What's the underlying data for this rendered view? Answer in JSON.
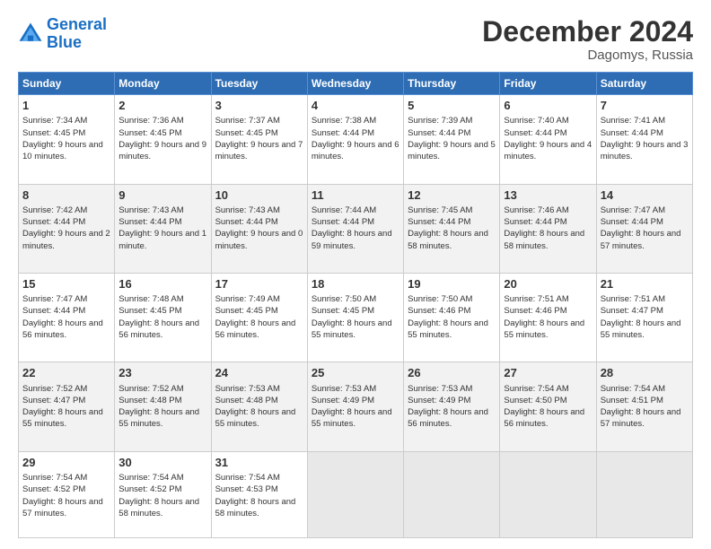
{
  "header": {
    "logo_line1": "General",
    "logo_line2": "Blue",
    "month": "December 2024",
    "location": "Dagomys, Russia"
  },
  "weekdays": [
    "Sunday",
    "Monday",
    "Tuesday",
    "Wednesday",
    "Thursday",
    "Friday",
    "Saturday"
  ],
  "weeks": [
    [
      {
        "day": "1",
        "sunrise": "Sunrise: 7:34 AM",
        "sunset": "Sunset: 4:45 PM",
        "daylight": "Daylight: 9 hours and 10 minutes."
      },
      {
        "day": "2",
        "sunrise": "Sunrise: 7:36 AM",
        "sunset": "Sunset: 4:45 PM",
        "daylight": "Daylight: 9 hours and 9 minutes."
      },
      {
        "day": "3",
        "sunrise": "Sunrise: 7:37 AM",
        "sunset": "Sunset: 4:45 PM",
        "daylight": "Daylight: 9 hours and 7 minutes."
      },
      {
        "day": "4",
        "sunrise": "Sunrise: 7:38 AM",
        "sunset": "Sunset: 4:44 PM",
        "daylight": "Daylight: 9 hours and 6 minutes."
      },
      {
        "day": "5",
        "sunrise": "Sunrise: 7:39 AM",
        "sunset": "Sunset: 4:44 PM",
        "daylight": "Daylight: 9 hours and 5 minutes."
      },
      {
        "day": "6",
        "sunrise": "Sunrise: 7:40 AM",
        "sunset": "Sunset: 4:44 PM",
        "daylight": "Daylight: 9 hours and 4 minutes."
      },
      {
        "day": "7",
        "sunrise": "Sunrise: 7:41 AM",
        "sunset": "Sunset: 4:44 PM",
        "daylight": "Daylight: 9 hours and 3 minutes."
      }
    ],
    [
      {
        "day": "8",
        "sunrise": "Sunrise: 7:42 AM",
        "sunset": "Sunset: 4:44 PM",
        "daylight": "Daylight: 9 hours and 2 minutes."
      },
      {
        "day": "9",
        "sunrise": "Sunrise: 7:43 AM",
        "sunset": "Sunset: 4:44 PM",
        "daylight": "Daylight: 9 hours and 1 minute."
      },
      {
        "day": "10",
        "sunrise": "Sunrise: 7:43 AM",
        "sunset": "Sunset: 4:44 PM",
        "daylight": "Daylight: 9 hours and 0 minutes."
      },
      {
        "day": "11",
        "sunrise": "Sunrise: 7:44 AM",
        "sunset": "Sunset: 4:44 PM",
        "daylight": "Daylight: 8 hours and 59 minutes."
      },
      {
        "day": "12",
        "sunrise": "Sunrise: 7:45 AM",
        "sunset": "Sunset: 4:44 PM",
        "daylight": "Daylight: 8 hours and 58 minutes."
      },
      {
        "day": "13",
        "sunrise": "Sunrise: 7:46 AM",
        "sunset": "Sunset: 4:44 PM",
        "daylight": "Daylight: 8 hours and 58 minutes."
      },
      {
        "day": "14",
        "sunrise": "Sunrise: 7:47 AM",
        "sunset": "Sunset: 4:44 PM",
        "daylight": "Daylight: 8 hours and 57 minutes."
      }
    ],
    [
      {
        "day": "15",
        "sunrise": "Sunrise: 7:47 AM",
        "sunset": "Sunset: 4:44 PM",
        "daylight": "Daylight: 8 hours and 56 minutes."
      },
      {
        "day": "16",
        "sunrise": "Sunrise: 7:48 AM",
        "sunset": "Sunset: 4:45 PM",
        "daylight": "Daylight: 8 hours and 56 minutes."
      },
      {
        "day": "17",
        "sunrise": "Sunrise: 7:49 AM",
        "sunset": "Sunset: 4:45 PM",
        "daylight": "Daylight: 8 hours and 56 minutes."
      },
      {
        "day": "18",
        "sunrise": "Sunrise: 7:50 AM",
        "sunset": "Sunset: 4:45 PM",
        "daylight": "Daylight: 8 hours and 55 minutes."
      },
      {
        "day": "19",
        "sunrise": "Sunrise: 7:50 AM",
        "sunset": "Sunset: 4:46 PM",
        "daylight": "Daylight: 8 hours and 55 minutes."
      },
      {
        "day": "20",
        "sunrise": "Sunrise: 7:51 AM",
        "sunset": "Sunset: 4:46 PM",
        "daylight": "Daylight: 8 hours and 55 minutes."
      },
      {
        "day": "21",
        "sunrise": "Sunrise: 7:51 AM",
        "sunset": "Sunset: 4:47 PM",
        "daylight": "Daylight: 8 hours and 55 minutes."
      }
    ],
    [
      {
        "day": "22",
        "sunrise": "Sunrise: 7:52 AM",
        "sunset": "Sunset: 4:47 PM",
        "daylight": "Daylight: 8 hours and 55 minutes."
      },
      {
        "day": "23",
        "sunrise": "Sunrise: 7:52 AM",
        "sunset": "Sunset: 4:48 PM",
        "daylight": "Daylight: 8 hours and 55 minutes."
      },
      {
        "day": "24",
        "sunrise": "Sunrise: 7:53 AM",
        "sunset": "Sunset: 4:48 PM",
        "daylight": "Daylight: 8 hours and 55 minutes."
      },
      {
        "day": "25",
        "sunrise": "Sunrise: 7:53 AM",
        "sunset": "Sunset: 4:49 PM",
        "daylight": "Daylight: 8 hours and 55 minutes."
      },
      {
        "day": "26",
        "sunrise": "Sunrise: 7:53 AM",
        "sunset": "Sunset: 4:49 PM",
        "daylight": "Daylight: 8 hours and 56 minutes."
      },
      {
        "day": "27",
        "sunrise": "Sunrise: 7:54 AM",
        "sunset": "Sunset: 4:50 PM",
        "daylight": "Daylight: 8 hours and 56 minutes."
      },
      {
        "day": "28",
        "sunrise": "Sunrise: 7:54 AM",
        "sunset": "Sunset: 4:51 PM",
        "daylight": "Daylight: 8 hours and 57 minutes."
      }
    ],
    [
      {
        "day": "29",
        "sunrise": "Sunrise: 7:54 AM",
        "sunset": "Sunset: 4:52 PM",
        "daylight": "Daylight: 8 hours and 57 minutes."
      },
      {
        "day": "30",
        "sunrise": "Sunrise: 7:54 AM",
        "sunset": "Sunset: 4:52 PM",
        "daylight": "Daylight: 8 hours and 58 minutes."
      },
      {
        "day": "31",
        "sunrise": "Sunrise: 7:54 AM",
        "sunset": "Sunset: 4:53 PM",
        "daylight": "Daylight: 8 hours and 58 minutes."
      },
      null,
      null,
      null,
      null
    ]
  ]
}
